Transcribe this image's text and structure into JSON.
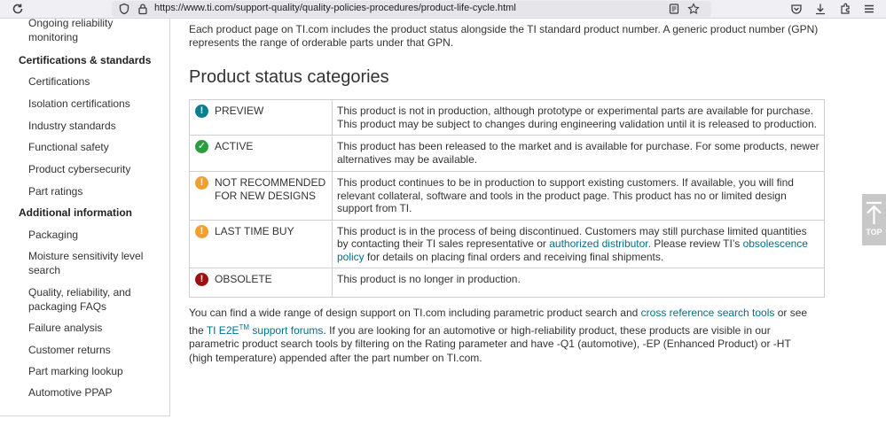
{
  "browser": {
    "url": "https://www.ti.com/support-quality/quality-policies-procedures/product-life-cycle.html"
  },
  "sidebar": {
    "items": [
      {
        "label": "Ongoing reliability monitoring",
        "kind": "sub"
      },
      {
        "label": "Certifications & standards",
        "kind": "head"
      },
      {
        "label": "Certifications",
        "kind": "sub"
      },
      {
        "label": "Isolation certifications",
        "kind": "sub"
      },
      {
        "label": "Industry standards",
        "kind": "sub"
      },
      {
        "label": "Functional safety",
        "kind": "sub"
      },
      {
        "label": "Product cybersecurity",
        "kind": "sub"
      },
      {
        "label": "Part ratings",
        "kind": "sub"
      },
      {
        "label": "Additional information",
        "kind": "head"
      },
      {
        "label": "Packaging",
        "kind": "sub"
      },
      {
        "label": "Moisture sensitivity level search",
        "kind": "sub"
      },
      {
        "label": "Quality, reliability, and packaging FAQs",
        "kind": "sub"
      },
      {
        "label": "Failure analysis",
        "kind": "sub"
      },
      {
        "label": "Customer returns",
        "kind": "sub"
      },
      {
        "label": "Part marking lookup",
        "kind": "sub"
      },
      {
        "label": "Automotive PPAP",
        "kind": "sub"
      }
    ]
  },
  "main": {
    "intro": "Each product page on TI.com includes the product status alongside the TI standard product number. A generic product number (GPN) represents the range of orderable parts under that GPN.",
    "heading": "Product status categories",
    "statuses": [
      {
        "icon": "!",
        "label": "PREVIEW",
        "description": "This product is not in production, although prototype or experimental parts are available for purchase. This product may be subject to changes during engineering validation until it is released to production."
      },
      {
        "icon": "✓",
        "label": "ACTIVE",
        "description": "This product has been released to the market and is available for purchase.  For some products, newer alternatives may be available."
      },
      {
        "icon": "!",
        "label": "NOT RECOMMENDED FOR NEW DESIGNS",
        "description": "This product continues to be in production to support existing customers. If available, you will find relevant collateral, software and tools in the product page. This product has no or limited design support from TI."
      },
      {
        "icon": "!",
        "label": "LAST TIME BUY",
        "description_parts": {
          "before": "This product is in the process of being discontinued. Customers may still purchase limited quantities by contacting their TI sales representative or ",
          "link1": "authorized distributor",
          "middle": ". Please review TI’s ",
          "link2": "obsolescence policy",
          "after": " for details on placing final orders and receiving final shipments."
        }
      },
      {
        "icon": "!",
        "label": "OBSOLETE",
        "description": "This product is no longer in production."
      }
    ],
    "outro": {
      "before": "You can find a wide range of design support on TI.com including parametric product search and ",
      "link1": "cross reference search tools",
      "middle": " or see the ",
      "link2a": "TI E2E",
      "link2sup": "TM",
      "link2b": " support forums",
      "after": ". If you are looking for an automotive or high-reliability product, these products are visible in our parametric product search tools by filtering on the Rating parameter and have -Q1 (automotive), -EP (Enhanced Product) or -HT (high temperature) appended after the part number on TI.com."
    }
  },
  "back_to_top": {
    "label": "TOP"
  },
  "colors": {
    "preview": "#0a7f8f",
    "active": "#2a9d3e",
    "nrnd": "#f0a030",
    "ltb": "#f0a030",
    "obsolete": "#a11010",
    "link": "#00708c"
  }
}
